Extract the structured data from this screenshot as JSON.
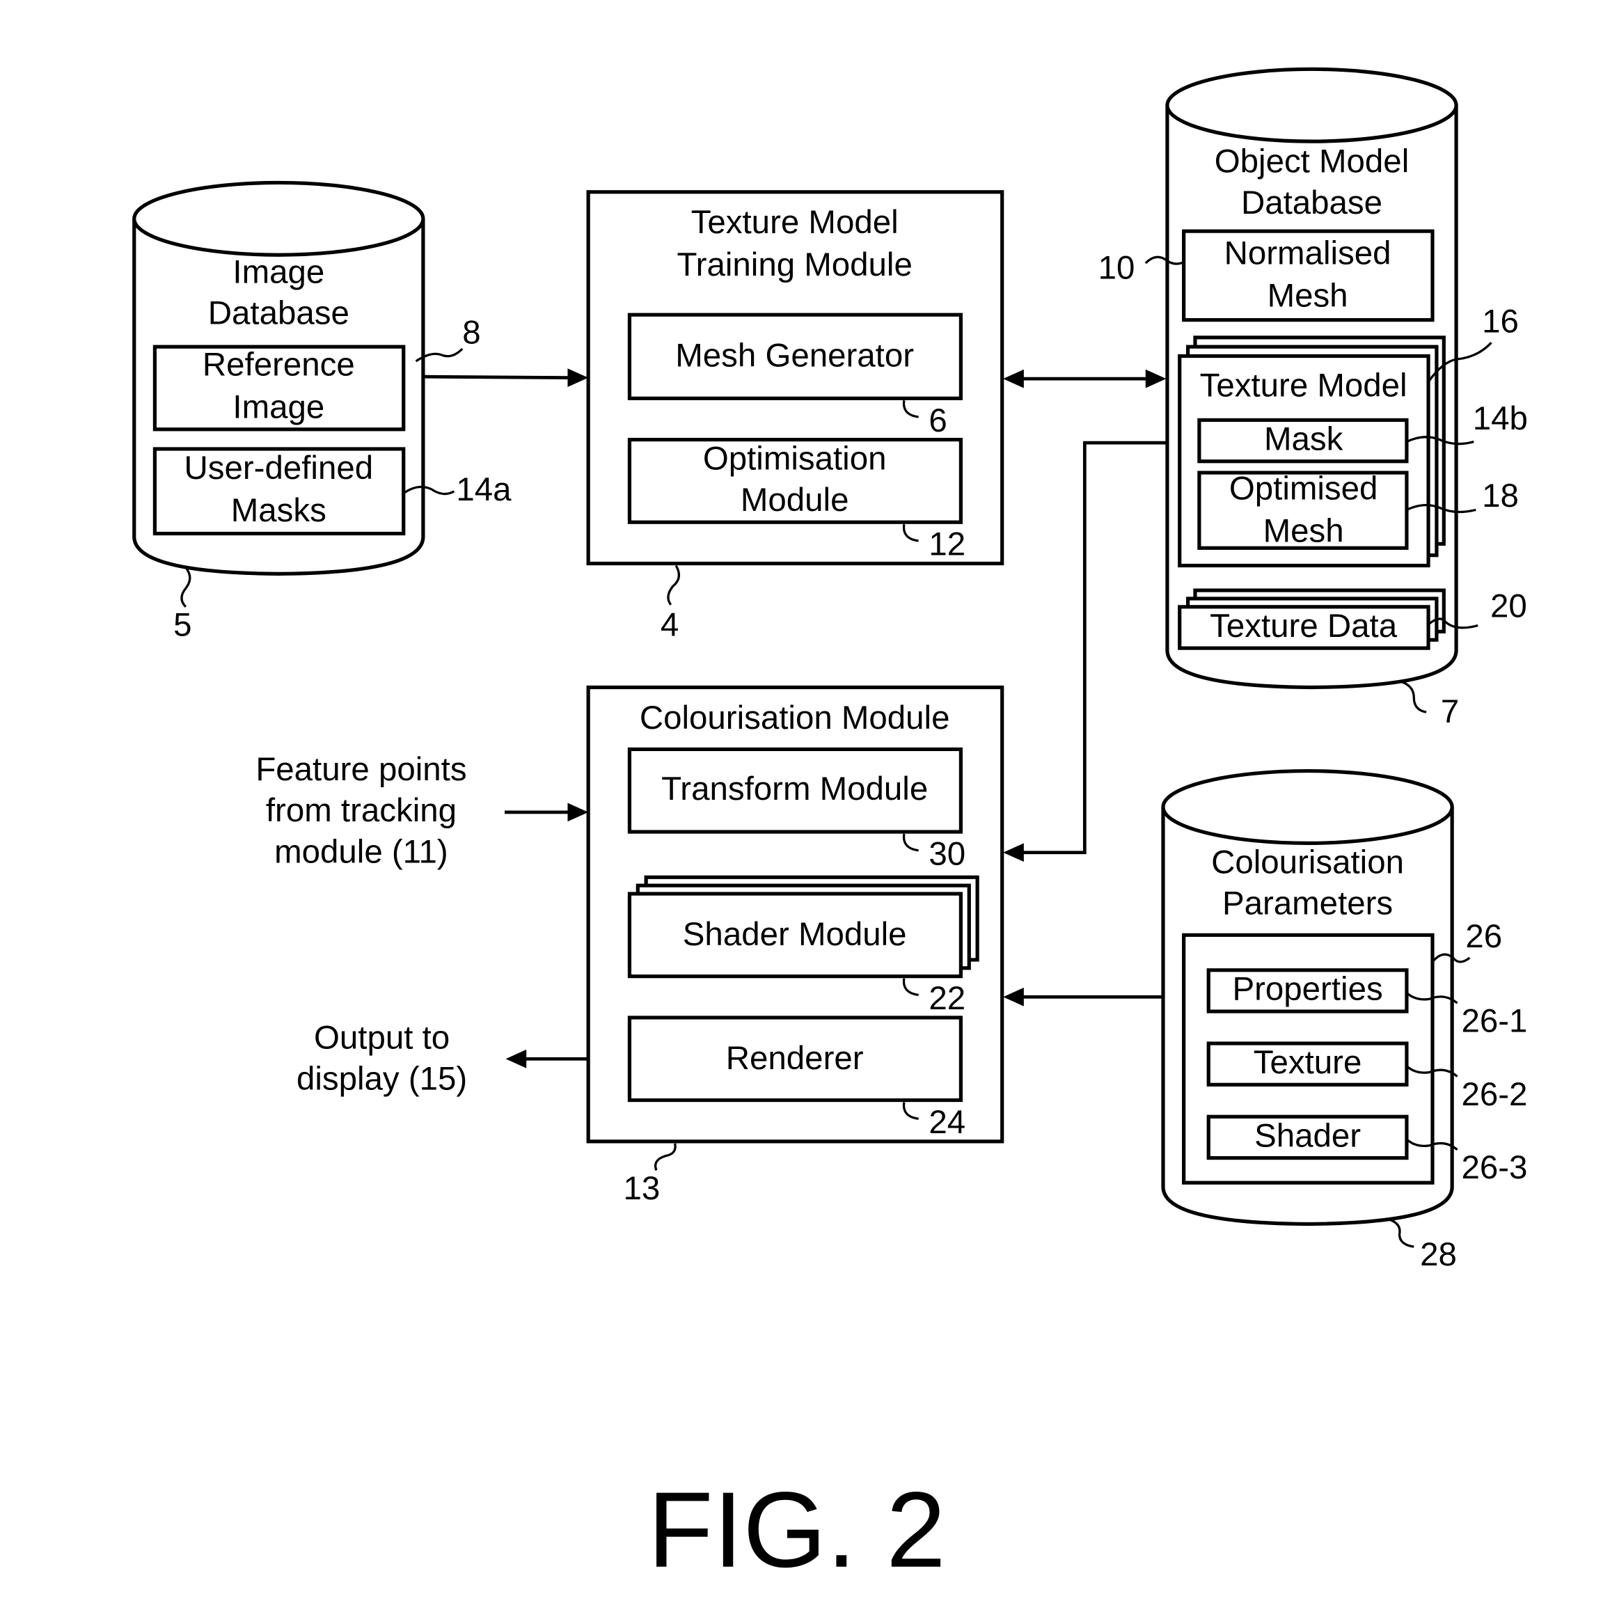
{
  "figure": {
    "caption": "FIG. 2"
  },
  "image_database": {
    "title_line1": "Image",
    "title_line2": "Database",
    "ref": "5",
    "items": [
      {
        "line1": "Reference",
        "line2": "Image",
        "ref": "8"
      },
      {
        "line1": "User-defined",
        "line2": "Masks",
        "ref": "14a"
      }
    ]
  },
  "training_module": {
    "title_line1": "Texture Model",
    "title_line2": "Training Module",
    "ref": "4",
    "items": [
      {
        "line1": "Mesh Generator",
        "line2": "",
        "ref": "6"
      },
      {
        "line1": "Optimisation",
        "line2": "Module",
        "ref": "12"
      }
    ]
  },
  "object_model_database": {
    "title_line1": "Object Model",
    "title_line2": "Database",
    "ref": "7",
    "normalised_mesh": {
      "line1": "Normalised",
      "line2": "Mesh",
      "ref": "10"
    },
    "texture_model": {
      "label": "Texture Model",
      "ref": "16",
      "mask": {
        "label": "Mask",
        "ref": "14b"
      },
      "optimised_mesh": {
        "line1": "Optimised",
        "line2": "Mesh",
        "ref": "18"
      }
    },
    "texture_data": {
      "label": "Texture Data",
      "ref": "20"
    }
  },
  "colourisation_module": {
    "title": "Colourisation Module",
    "ref": "13",
    "transform": {
      "label": "Transform Module",
      "ref": "30"
    },
    "shader": {
      "label": "Shader Module",
      "ref": "22"
    },
    "renderer": {
      "label": "Renderer",
      "ref": "24"
    }
  },
  "inputs": {
    "feature_points_line1": "Feature points",
    "feature_points_line2": "from tracking",
    "feature_points_line3": "module (11)",
    "output_line1": "Output to",
    "output_line2": "display (15)"
  },
  "colourisation_parameters": {
    "title_line1": "Colourisation",
    "title_line2": "Parameters",
    "ref": "28",
    "group_ref": "26",
    "items": [
      {
        "label": "Properties",
        "ref": "26-1"
      },
      {
        "label": "Texture",
        "ref": "26-2"
      },
      {
        "label": "Shader",
        "ref": "26-3"
      }
    ]
  }
}
